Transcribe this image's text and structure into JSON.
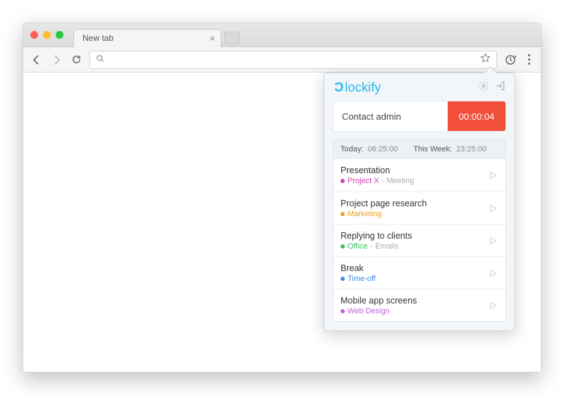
{
  "browser": {
    "tab_title": "New tab",
    "tab_close": "×"
  },
  "popup": {
    "brand": "lockify",
    "tracker": {
      "description": "Contact admin",
      "elapsed": "00:00:04"
    },
    "summary": {
      "today_label": "Today:",
      "today_value": "06:25:00",
      "week_label": "This Week:",
      "week_value": "23:25:00"
    },
    "entries": [
      {
        "title": "Presentation",
        "project": "Project X",
        "project_color": "#d63fb0",
        "task": "Meeting"
      },
      {
        "title": "Project page research",
        "project": "Marketing",
        "project_color": "#f0a020",
        "task": ""
      },
      {
        "title": "Replying to clients",
        "project": "Office",
        "project_color": "#3fbf5f",
        "task": "Emails"
      },
      {
        "title": "Break",
        "project": "Time-off",
        "project_color": "#3f8fe0",
        "task": ""
      },
      {
        "title": "Mobile app screens",
        "project": "Web Design",
        "project_color": "#c060e0",
        "task": ""
      }
    ]
  }
}
